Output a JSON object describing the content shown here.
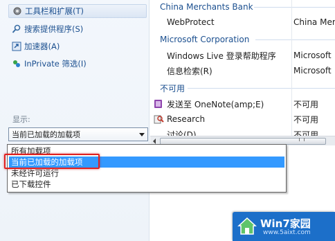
{
  "sidebar": {
    "items": [
      {
        "label": "工具栏和扩展(T)",
        "icon": "gear-icon"
      },
      {
        "label": "搜索提供程序(S)",
        "icon": "search-icon"
      },
      {
        "label": "加速器(A)",
        "icon": "accelerator-icon"
      },
      {
        "label": "InPrivate 筛选(I)",
        "icon": "inprivate-icon"
      }
    ],
    "show_label": "显示:",
    "combo_value": "当前已加载的加载项"
  },
  "dropdown": {
    "options": [
      "所有加载项",
      "当前已加载的加载项",
      "未经许可运行",
      "已下载控件"
    ],
    "highlighted_index": 1
  },
  "list": {
    "groups": [
      {
        "name": "China Merchants Bank",
        "rows": [
          {
            "name": "WebProtect",
            "publisher": "China Mer"
          }
        ]
      },
      {
        "name": "Microsoft Corporation",
        "rows": [
          {
            "name": "Windows Live 登录帮助程序",
            "publisher": "Microsoft"
          },
          {
            "name": "信息检索(R)",
            "publisher": "Microsoft"
          }
        ]
      },
      {
        "name": "不可用",
        "rows": [
          {
            "name": "发送至 OneNote(amp;E)",
            "status": "不可用",
            "icon": "onenote-icon"
          },
          {
            "name": "Research",
            "status": "不可用",
            "icon": "research-icon"
          },
          {
            "name": "讨论(D)",
            "status": "不可用"
          }
        ]
      }
    ]
  },
  "watermark": {
    "name": "Win7家园",
    "url": "www.5aixt.com",
    "color": "#1c6fc9"
  },
  "colors": {
    "accent": "#3399ff",
    "highlight_border": "#e02020",
    "group_text": "#1b4f8f"
  }
}
